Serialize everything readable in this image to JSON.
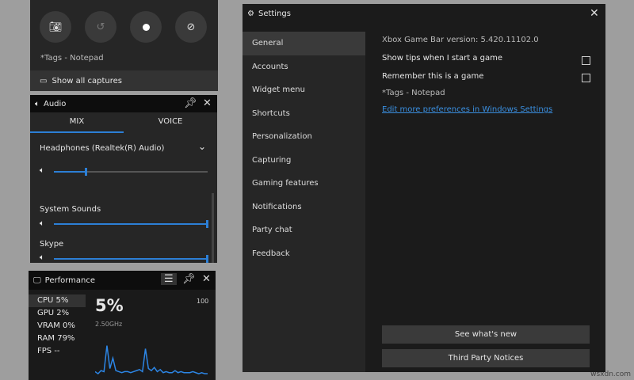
{
  "capture": {
    "tags": "*Tags - Notepad",
    "show_all": "Show all captures"
  },
  "audio": {
    "title": "Audio",
    "tabs": [
      "MIX",
      "VOICE"
    ],
    "device": "Headphones (Realtek(R) Audio)",
    "device_volume": 0.2,
    "apps": [
      {
        "name": "System Sounds",
        "volume": 1.0
      },
      {
        "name": "Skype",
        "volume": 1.0
      }
    ]
  },
  "performance": {
    "title": "Performance",
    "stats": [
      {
        "label": "CPU",
        "value": "5%"
      },
      {
        "label": "GPU",
        "value": "2%"
      },
      {
        "label": "VRAM",
        "value": "0%"
      },
      {
        "label": "RAM",
        "value": "79%"
      },
      {
        "label": "FPS",
        "value": "--"
      }
    ],
    "big_value": "5%",
    "freq": "2.50GHz",
    "max": "100",
    "history": [
      5,
      3,
      6,
      5,
      30,
      8,
      18,
      6,
      5,
      4,
      5,
      5,
      4,
      5,
      6,
      7,
      5,
      27,
      8,
      6,
      9,
      5,
      7,
      4,
      5,
      4,
      4,
      6,
      4,
      5,
      4,
      4,
      4,
      5,
      4,
      3,
      4,
      3,
      3
    ]
  },
  "settings": {
    "title": "Settings",
    "nav": [
      "General",
      "Accounts",
      "Widget menu",
      "Shortcuts",
      "Personalization",
      "Capturing",
      "Gaming features",
      "Notifications",
      "Party chat",
      "Feedback"
    ],
    "version": "Xbox Game Bar version: 5.420.11102.0",
    "options": [
      {
        "label": "Show tips when I start a game",
        "checked": false
      },
      {
        "label": "Remember this is a game",
        "checked": false
      }
    ],
    "tags": "*Tags - Notepad",
    "link": "Edit more preferences in Windows Settings",
    "buttons": [
      "See what's new",
      "Third Party Notices"
    ]
  },
  "watermark": "wsxdn.com"
}
